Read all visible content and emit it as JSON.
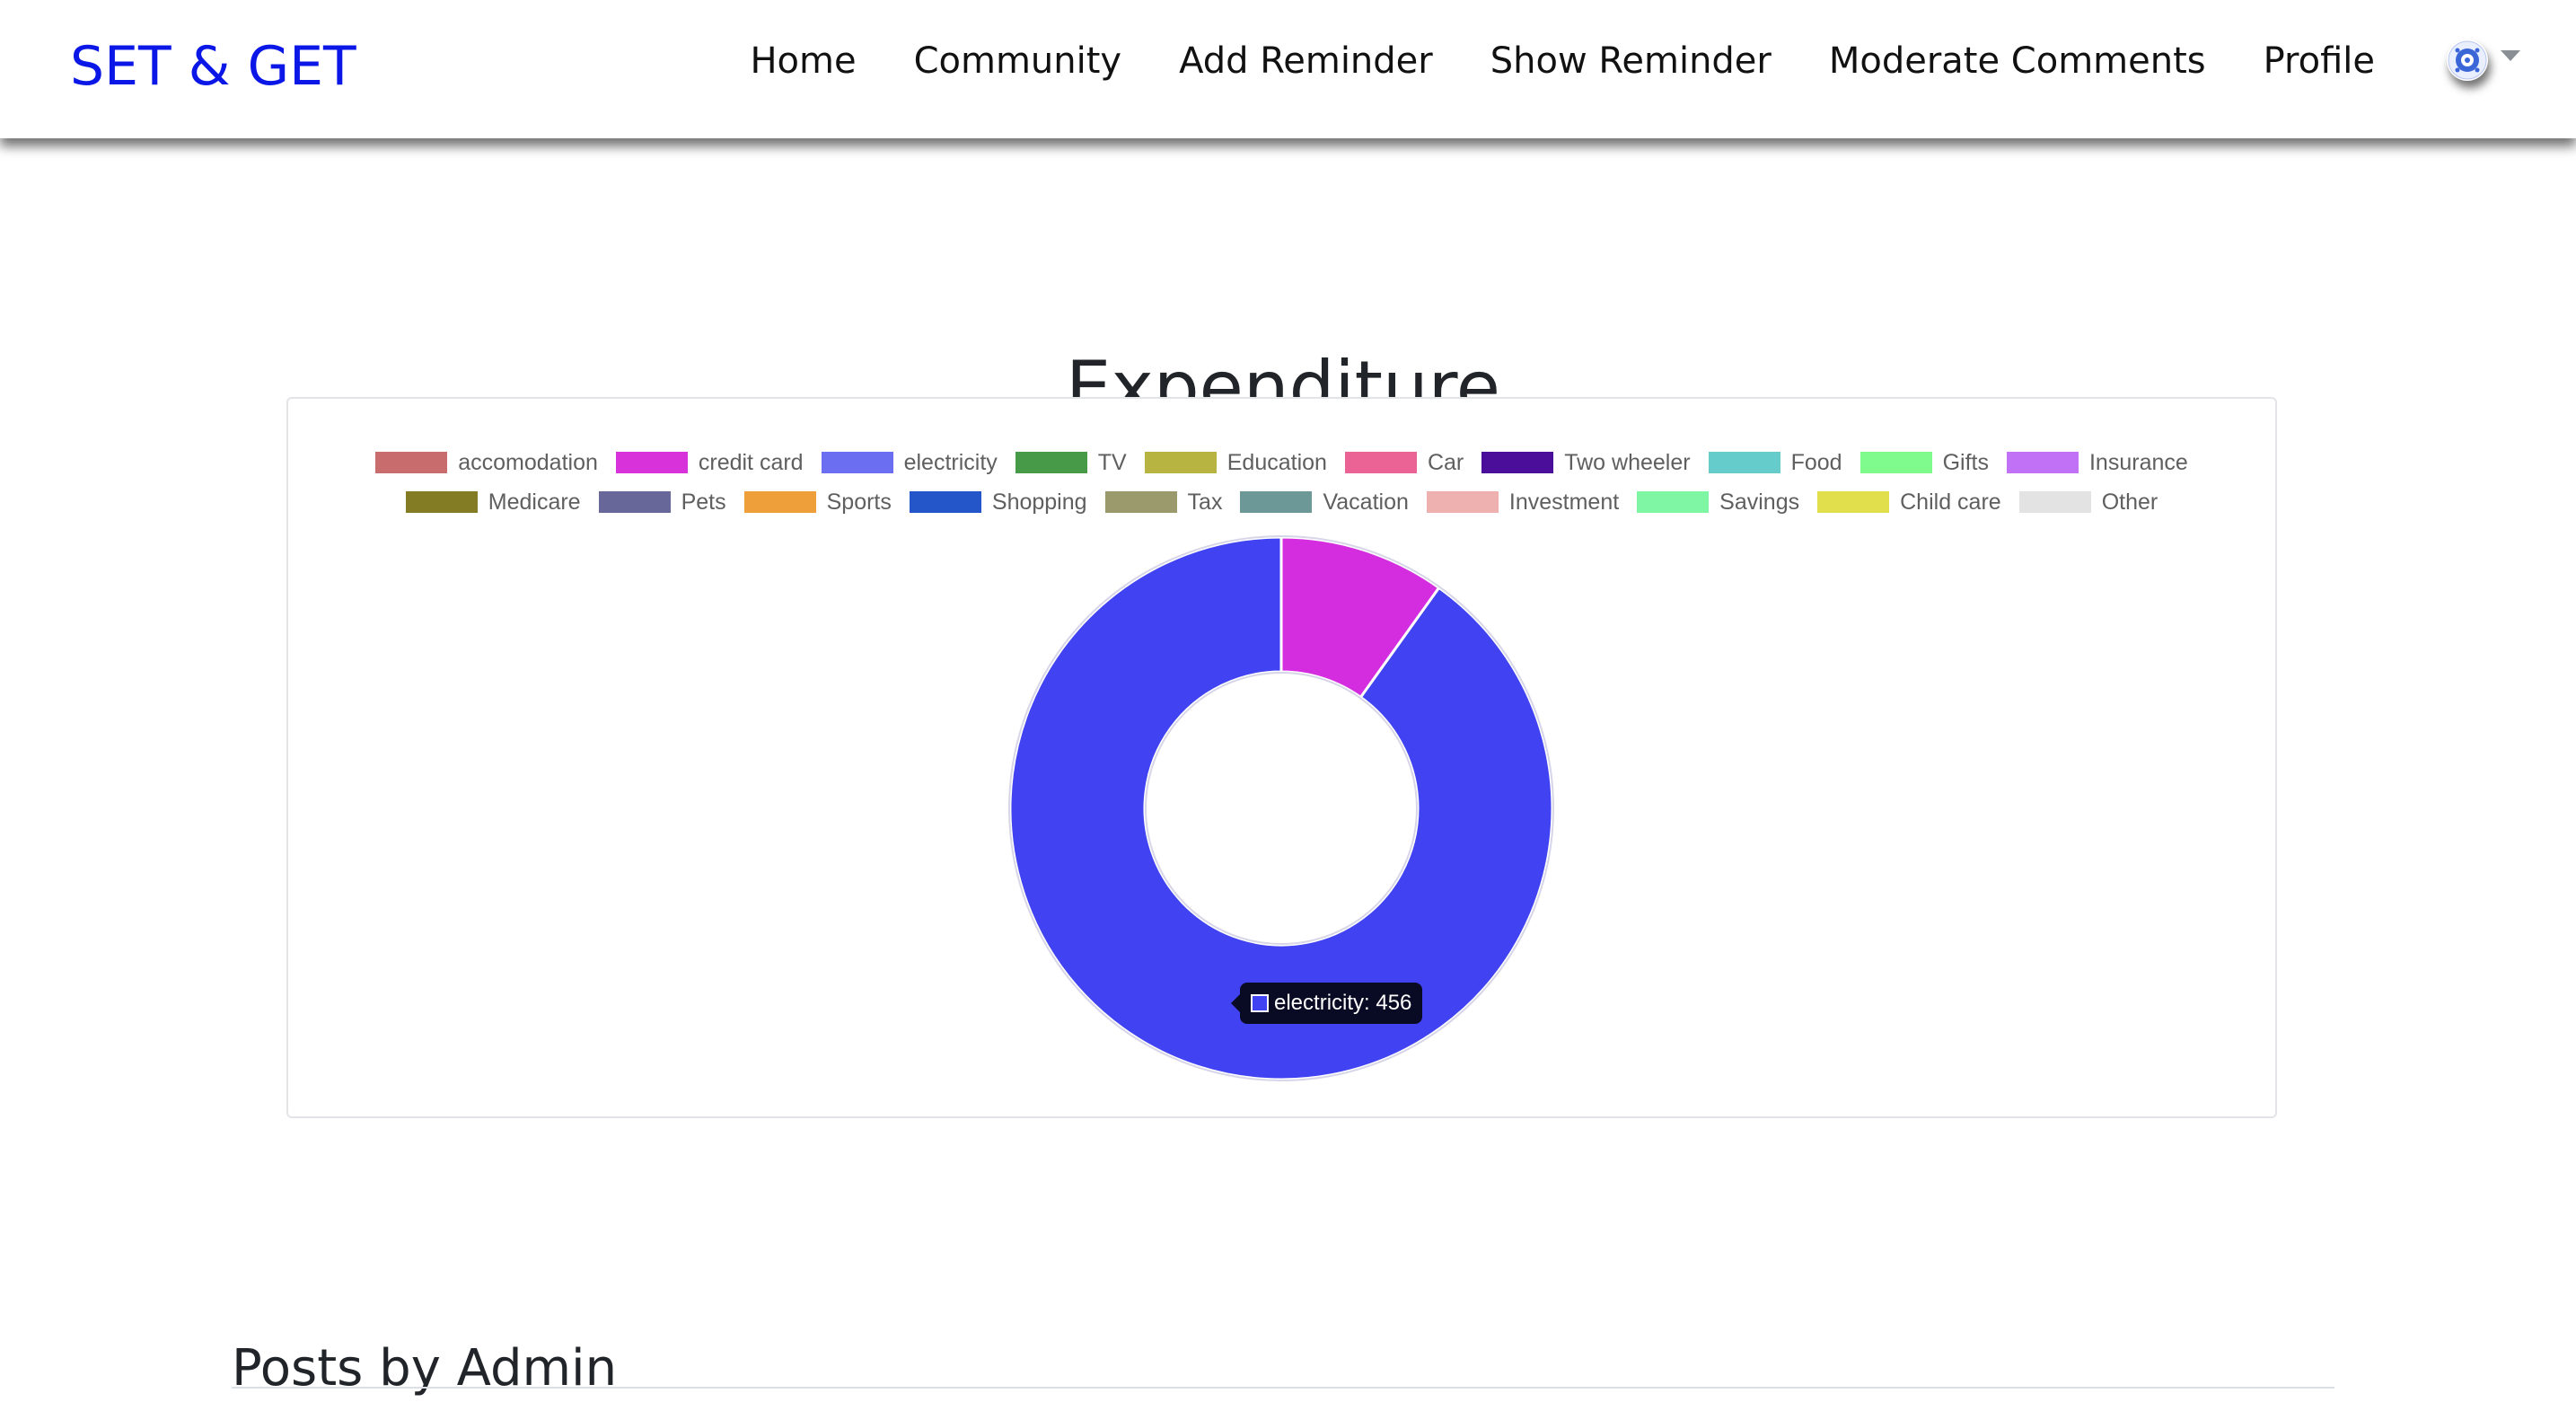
{
  "navbar": {
    "brand": "SET & GET",
    "links": [
      {
        "label": "Home"
      },
      {
        "label": "Community"
      },
      {
        "label": "Add Reminder"
      },
      {
        "label": "Show Reminder"
      },
      {
        "label": "Moderate Comments"
      },
      {
        "label": "Profile"
      }
    ],
    "avatar_icon": "user-avatar-icon",
    "dropdown_icon": "caret-down-icon"
  },
  "main": {
    "section_title": "Expenditure",
    "posts_title": "Posts by Admin"
  },
  "tooltip": {
    "text": "electricity: 456",
    "color": "#4143f2"
  },
  "chart_data": {
    "type": "pie",
    "variant": "doughnut",
    "title": "",
    "legend_position": "top",
    "categories": [
      "accomodation",
      "credit card",
      "electricity",
      "TV",
      "Education",
      "Car",
      "Two wheeler",
      "Food",
      "Gifts",
      "Insurance",
      "Medicare",
      "Pets",
      "Sports",
      "Shopping",
      "Tax",
      "Vacation",
      "Investment",
      "Savings",
      "Child care",
      "Other"
    ],
    "values": [
      0,
      50,
      456,
      0,
      0,
      0,
      0,
      0,
      0,
      0,
      0,
      0,
      0,
      0,
      0,
      0,
      0,
      0,
      0,
      0
    ],
    "legend_colors": [
      "#c96c6e",
      "#d833db",
      "#6b6ef0",
      "#479a47",
      "#b8b441",
      "#ea6394",
      "#4a0e9b",
      "#66cbcb",
      "#7ffa8d",
      "#c071f5",
      "#847c24",
      "#67679a",
      "#ef9f3a",
      "#2456c9",
      "#9a9a6c",
      "#6c9898",
      "#eeb1b0",
      "#7ff6a4",
      "#e1e04c",
      "#e3e3e3"
    ],
    "slice_colors": [
      "#c96c6e",
      "#d42ddf",
      "#4143f2",
      "#479a47",
      "#b8b441",
      "#ea6394",
      "#4a0e9b",
      "#66cbcb",
      "#7ffa8d",
      "#c071f5",
      "#847c24",
      "#67679a",
      "#ef9f3a",
      "#2456c9",
      "#9a9a6c",
      "#6c9898",
      "#eeb1b0",
      "#7ff6a4",
      "#e1e04c",
      "#e3e3e3"
    ]
  }
}
